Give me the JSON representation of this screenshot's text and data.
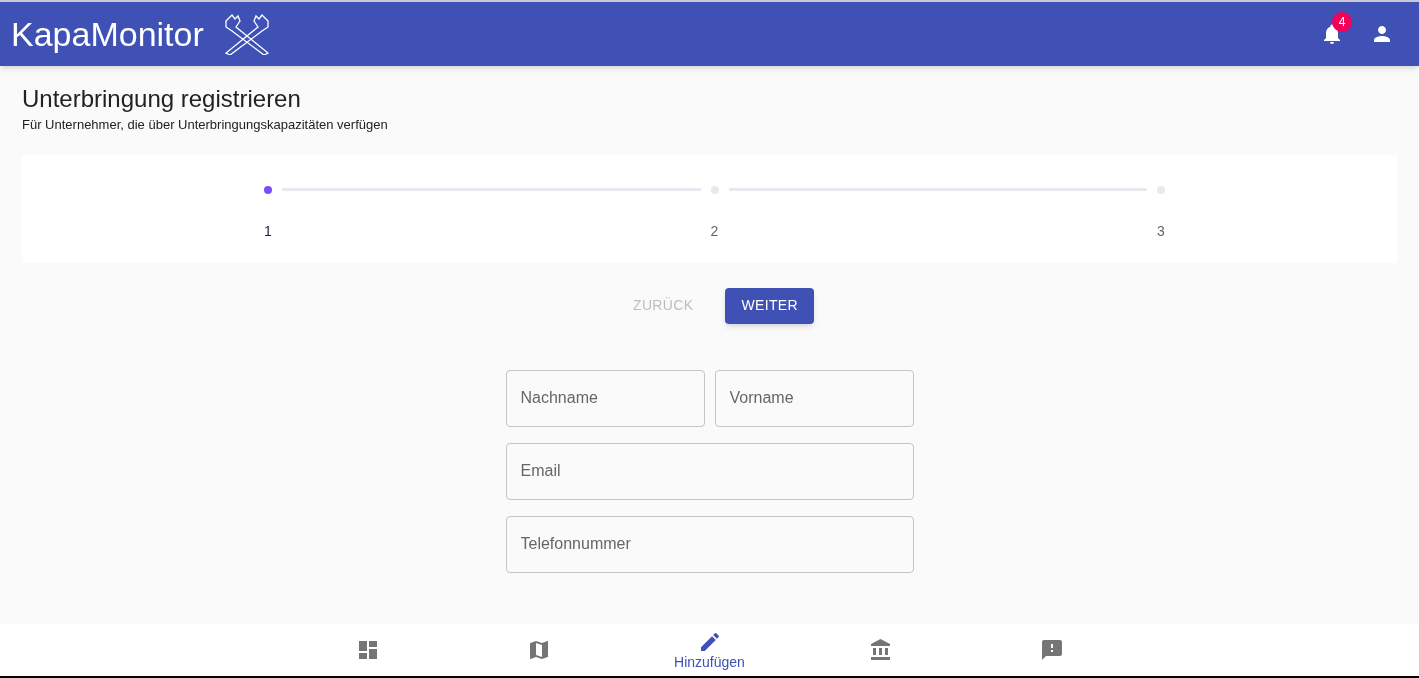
{
  "app_bar": {
    "title": "KapaMonitor",
    "notification_count": "4"
  },
  "page": {
    "title": "Unterbringung registrieren",
    "subtitle": "Für Unternehmer, die über Unterbringungskapazitäten verfügen"
  },
  "stepper": {
    "steps": [
      {
        "label": "1",
        "selected": true
      },
      {
        "label": "2",
        "selected": false
      },
      {
        "label": "3",
        "selected": false
      }
    ]
  },
  "buttons": [
    {
      "label": "ZURÜCK",
      "disabled": true,
      "kind": "text"
    },
    {
      "label": "WEITER",
      "disabled": false,
      "kind": "contained"
    }
  ],
  "form": {
    "rows": [
      [
        {
          "placeholder": "Nachname"
        },
        {
          "placeholder": "Vorname"
        }
      ],
      [
        {
          "placeholder": "Email"
        }
      ],
      [
        {
          "placeholder": "Telefonnummer"
        }
      ]
    ]
  },
  "bottom_nav": [
    {
      "kind": "dashboard",
      "selected": false
    },
    {
      "kind": "map",
      "selected": false
    },
    {
      "kind": "edit",
      "label": "Hinzufügen",
      "selected": true
    },
    {
      "kind": "bank",
      "selected": false
    },
    {
      "kind": "feedback",
      "selected": false
    }
  ]
}
